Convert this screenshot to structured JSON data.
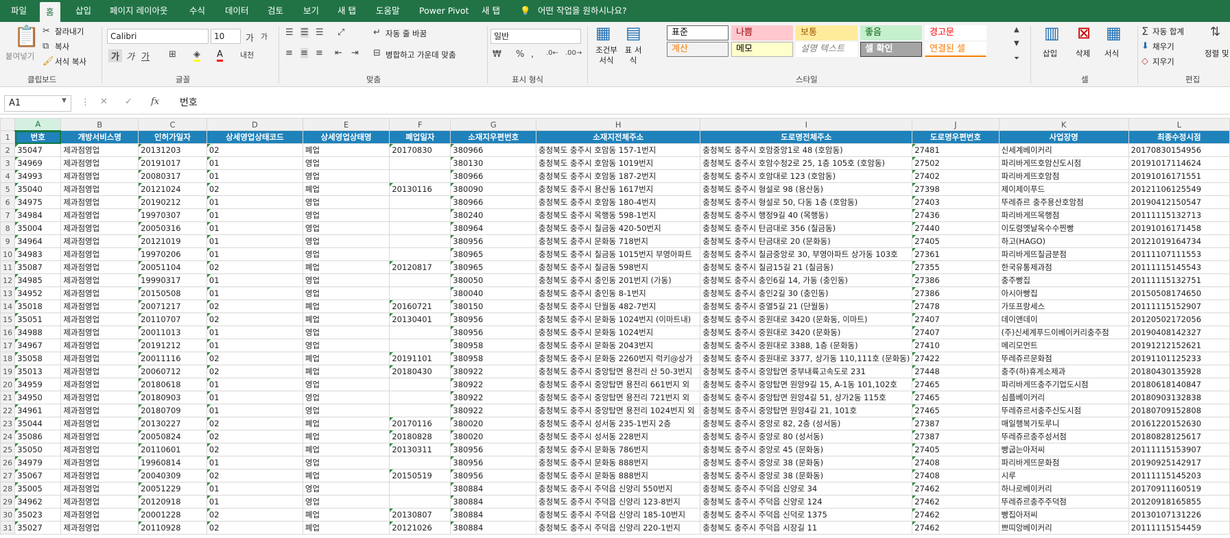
{
  "ribbon_tabs": [
    "파일",
    "홈",
    "삽입",
    "페이지 레이아웃",
    "수식",
    "데이터",
    "검토",
    "보기",
    "새 탭",
    "도움말",
    "Power Pivot",
    "새 탭"
  ],
  "tell_me": "어떤 작업을 원하시나요?",
  "clipboard": {
    "paste": "붙여넣기",
    "cut": "잘라내기",
    "copy": "복사",
    "format_painter": "서식 복사",
    "label": "클립보드"
  },
  "font": {
    "name": "Calibri",
    "size": "10",
    "label": "글꼴",
    "bold": "가",
    "italic": "가",
    "underline": "가",
    "ga_up": "가",
    "ga_down": "가",
    "phonetic": "내천"
  },
  "alignment": {
    "wrap": "자동 줄 바꿈",
    "merge": "병합하고 가운데 맞춤",
    "label": "맞춤"
  },
  "number": {
    "format": "일반",
    "label": "표시 형식"
  },
  "styles": {
    "cond_format": "조건부 서식",
    "table_format": "표 서식",
    "cells": [
      {
        "text": "표준",
        "bg": "#ffffff",
        "fg": "#000000",
        "border": "#666666"
      },
      {
        "text": "나쁨",
        "bg": "#ffc7ce",
        "fg": "#9c0006",
        "border": "#ffc7ce"
      },
      {
        "text": "보통",
        "bg": "#ffeb9c",
        "fg": "#9c5700",
        "border": "#ffeb9c"
      },
      {
        "text": "좋음",
        "bg": "#c6efce",
        "fg": "#006100",
        "border": "#c6efce"
      },
      {
        "text": "경고문",
        "bg": "#ffffff",
        "fg": "#ff0000",
        "border": "#ffffff"
      },
      {
        "text": "계산",
        "bg": "#f2f2f2",
        "fg": "#fa7d00",
        "border": "#7f7f7f"
      },
      {
        "text": "메모",
        "bg": "#ffffcc",
        "fg": "#000000",
        "border": "#b2b2b2"
      },
      {
        "text": "설명 텍스트",
        "bg": "#ffffff",
        "fg": "#7f7f7f",
        "border": "#ffffff"
      },
      {
        "text": "셀 확인",
        "bg": "#a5a5a5",
        "fg": "#ffffff",
        "border": "#3f3f3f"
      },
      {
        "text": "연결된 셀",
        "bg": "#ffffff",
        "fg": "#fa7d00",
        "border": "#ffffff"
      }
    ],
    "label": "스타일"
  },
  "cells_group": {
    "insert": "삽입",
    "delete": "삭제",
    "format": "서식",
    "label": "셀"
  },
  "editing": {
    "autosum": "자동 합계",
    "fill": "채우기",
    "clear": "지우기",
    "sort": "정렬 및 필터",
    "label": "편집"
  },
  "name_box": "A1",
  "formula": "번호",
  "columns": [
    "A",
    "B",
    "C",
    "D",
    "E",
    "F",
    "G",
    "H",
    "I",
    "J",
    "K",
    "L"
  ],
  "headers": [
    "번호",
    "개방서비스명",
    "인허가일자",
    "상세영업상태코드",
    "상세영업상태명",
    "폐업일자",
    "소재지우편번호",
    "소재지전체주소",
    "도로명전체주소",
    "도로명우편번호",
    "사업장명",
    "최종수정시점"
  ],
  "rows": [
    [
      "35047",
      "제과점영업",
      "20131203",
      "02",
      "폐업",
      "20170830",
      "380966",
      "충청북도 충주시 호암동 157-1번지",
      "충청북도 충주시 호암중앙1로 48 (호암동)",
      "27481",
      "신세계베이커리",
      "20170830154956"
    ],
    [
      "34969",
      "제과점영업",
      "20191017",
      "01",
      "영업",
      "",
      "380130",
      "충청북도 충주시 호암동 1019번지",
      "충청북도 충주시 호암수청2로 25, 1층 105호 (호암동)",
      "27502",
      "파리바게뜨호암신도시점",
      "20191017114624"
    ],
    [
      "34993",
      "제과점영업",
      "20080317",
      "01",
      "영업",
      "",
      "380966",
      "충청북도 충주시 호암동 187-2번지",
      "충청북도 충주시 호암대로 123 (호암동)",
      "27402",
      "파리바게뜨호암점",
      "20191016171551"
    ],
    [
      "35040",
      "제과점영업",
      "20121024",
      "02",
      "폐업",
      "20130116",
      "380090",
      "충청북도 충주시 용산동 1617번지",
      "충청북도 충주시 형설로 98 (용산동)",
      "27398",
      "제이제이푸드",
      "20121106125549"
    ],
    [
      "34975",
      "제과점영업",
      "20190212",
      "01",
      "영업",
      "",
      "380966",
      "충청북도 충주시 호암동 180-4번지",
      "충청북도 충주시 형설로 50, 다동 1층 (호암동)",
      "27403",
      "뚜레쥬르 충주용산호암점",
      "20190412150547"
    ],
    [
      "34984",
      "제과점영업",
      "19970307",
      "01",
      "영업",
      "",
      "380240",
      "충청북도 충주시 목행동 598-1번지",
      "충청북도 충주시 행정9길 40 (목행동)",
      "27436",
      "파리바게뜨목행점",
      "20111115132713"
    ],
    [
      "35004",
      "제과점영업",
      "20050316",
      "01",
      "영업",
      "",
      "380964",
      "충청북도 충주시 칠금동 420-50번지",
      "충청북도 충주시 탄금대로 356 (칠금동)",
      "27440",
      "이도령옛날옥수수찐빵",
      "20191016171458"
    ],
    [
      "34964",
      "제과점영업",
      "20121019",
      "01",
      "영업",
      "",
      "380956",
      "충청북도 충주시 문화동 718번지",
      "충청북도 충주시 탄금대로 20 (문화동)",
      "27405",
      "하고(HAGO)",
      "20121019164734"
    ],
    [
      "34983",
      "제과점영업",
      "19970206",
      "01",
      "영업",
      "",
      "380965",
      "충청북도 충주시 칠금동 1015번지 부영아파트",
      "충청북도 충주시 칠금중앙로 30, 부영아파트 상가동 103호",
      "27361",
      "파리바게뜨칠금분점",
      "20111107111553"
    ],
    [
      "35087",
      "제과점영업",
      "20051104",
      "02",
      "폐업",
      "20120817",
      "380965",
      "충청북도 충주시 칠금동 598번지",
      "충청북도 충주시 칠금15길 21 (칠금동)",
      "27355",
      "한국유통제과점",
      "20111115145543"
    ],
    [
      "34985",
      "제과점영업",
      "19990317",
      "01",
      "영업",
      "",
      "380050",
      "충청북도 충주시 충인동 201번지 (가동)",
      "충청북도 충주시 충인6길 14, 가동 (충인동)",
      "27386",
      "충주빵집",
      "20111115132751"
    ],
    [
      "34952",
      "제과점영업",
      "20150508",
      "01",
      "영업",
      "",
      "380040",
      "충청북도 충주시 충인동 8-1번지",
      "충청북도 충주시 충인2길 30 (충인동)",
      "27386",
      "아시아빵집",
      "20150508174650"
    ],
    [
      "35018",
      "제과점영업",
      "20071217",
      "02",
      "폐업",
      "20160721",
      "380150",
      "충청북도 충주시 단월동 482-7번지",
      "충청북도 충주시 중열5길 21 (단월동)",
      "27478",
      "가또프랑세스",
      "20111115152907"
    ],
    [
      "35051",
      "제과점영업",
      "20110707",
      "02",
      "폐업",
      "20130401",
      "380956",
      "충청북도 충주시 문화동 1024번지 (이마트내)",
      "충청북도 충주시 중원대로 3420 (문화동, 이마트)",
      "27407",
      "데이앤데이",
      "20120502172056"
    ],
    [
      "34988",
      "제과점영업",
      "20011013",
      "01",
      "영업",
      "",
      "380956",
      "충청북도 충주시 문화동 1024번지",
      "충청북도 충주시 중원대로 3420 (문화동)",
      "27407",
      "(주)신세계푸드이베이커리충주점",
      "20190408142327"
    ],
    [
      "34967",
      "제과점영업",
      "20191212",
      "01",
      "영업",
      "",
      "380958",
      "충청북도 충주시 문화동 2043번지",
      "충청북도 충주시 중원대로 3388, 1층 (문화동)",
      "27410",
      "메리모먼트",
      "20191212152621"
    ],
    [
      "35058",
      "제과점영업",
      "20011116",
      "02",
      "폐업",
      "20191101",
      "380958",
      "충청북도 충주시 문화동 2260번지 럭키@상가",
      "충청북도 충주시 중원대로 3377, 상가동 110,111호 (문화동)",
      "27422",
      "뚜레쥬르문화점",
      "20191101125233"
    ],
    [
      "35013",
      "제과점영업",
      "20060712",
      "02",
      "폐업",
      "20180430",
      "380922",
      "충청북도 충주시 중앙탑면 용전리 산 50-3번지",
      "충청북도 충주시 중앙탑면 중부내륙고속도로 231",
      "27448",
      "충주(하)휴게소제과",
      "20180430135928"
    ],
    [
      "34959",
      "제과점영업",
      "20180618",
      "01",
      "영업",
      "",
      "380922",
      "충청북도 충주시 중앙탑면 용전리 661번지 외",
      "충청북도 충주시 중앙탑면 원앙9길 15, A-1동 101,102호",
      "27465",
      "파리바게뜨충주기업도시점",
      "20180618140847"
    ],
    [
      "34950",
      "제과점영업",
      "20180903",
      "01",
      "영업",
      "",
      "380922",
      "충청북도 충주시 중앙탑면 용전리 721번지 외",
      "충청북도 충주시 중앙탑면 원앙4길 51, 상가2동 115호",
      "27465",
      "심플베이커리",
      "20180903132838"
    ],
    [
      "34961",
      "제과점영업",
      "20180709",
      "01",
      "영업",
      "",
      "380922",
      "충청북도 충주시 중앙탑면 용전리 1024번지 외",
      "충청북도 충주시 중앙탑면 원앙4길 21, 101호",
      "27465",
      "뚜레쥬르서충주신도시점",
      "20180709152808"
    ],
    [
      "35044",
      "제과점영업",
      "20130227",
      "02",
      "폐업",
      "20170116",
      "380020",
      "충청북도 충주시 성서동 235-1번지 2층",
      "충청북도 충주시 중앙로 82, 2층 (성서동)",
      "27387",
      "매일행복가토루니",
      "20161220152630"
    ],
    [
      "35086",
      "제과점영업",
      "20050824",
      "02",
      "폐업",
      "20180828",
      "380020",
      "충청북도 충주시 성서동 228번지",
      "충청북도 충주시 중앙로 80 (성서동)",
      "27387",
      "뚜레쥬르충주성서점",
      "20180828125617"
    ],
    [
      "35050",
      "제과점영업",
      "20110601",
      "02",
      "폐업",
      "20130311",
      "380956",
      "충청북도 충주시 문화동 786번지",
      "충청북도 충주시 중앙로 45 (문화동)",
      "27405",
      "빵굽는아저씨",
      "20111115153907"
    ],
    [
      "34979",
      "제과점영업",
      "19960814",
      "01",
      "영업",
      "",
      "380956",
      "충청북도 충주시 문화동 888번지",
      "충청북도 충주시 중앙로 38 (문화동)",
      "27408",
      "파리바게뜨문화점",
      "20190925142917"
    ],
    [
      "35067",
      "제과점영업",
      "20040309",
      "02",
      "폐업",
      "20150519",
      "380956",
      "충청북도 충주시 문화동 888번지",
      "충청북도 충주시 중앙로 38 (문화동)",
      "27408",
      "시루",
      "20111115145203"
    ],
    [
      "35005",
      "제과점영업",
      "20051229",
      "01",
      "영업",
      "",
      "380884",
      "충청북도 충주시 주덕읍 신양리 550번지",
      "충청북도 충주시 주덕읍 신양로 34",
      "27462",
      "하나로베이커리",
      "20170911160519"
    ],
    [
      "34962",
      "제과점영업",
      "20120918",
      "01",
      "영업",
      "",
      "380884",
      "충청북도 충주시 주덕읍 신양리 123-8번지",
      "충청북도 충주시 주덕읍 신양로 124",
      "27462",
      "뚜레쥬르충주주덕점",
      "20120918165855"
    ],
    [
      "35023",
      "제과점영업",
      "20001228",
      "02",
      "폐업",
      "20130807",
      "380884",
      "충청북도 충주시 주덕읍 신양리 185-10번지",
      "충청북도 충주시 주덕읍 신덕로 1375",
      "27462",
      "빵집아저씨",
      "20130107131226"
    ],
    [
      "35027",
      "제과점영업",
      "20110928",
      "02",
      "폐업",
      "20121026",
      "380884",
      "충청북도 충주시 주덕읍 신양리 220-1번지",
      "충청북도 충주시 주덕읍 시장길 11",
      "27462",
      "쁘띠앙베이커리",
      "20111115154459"
    ]
  ]
}
